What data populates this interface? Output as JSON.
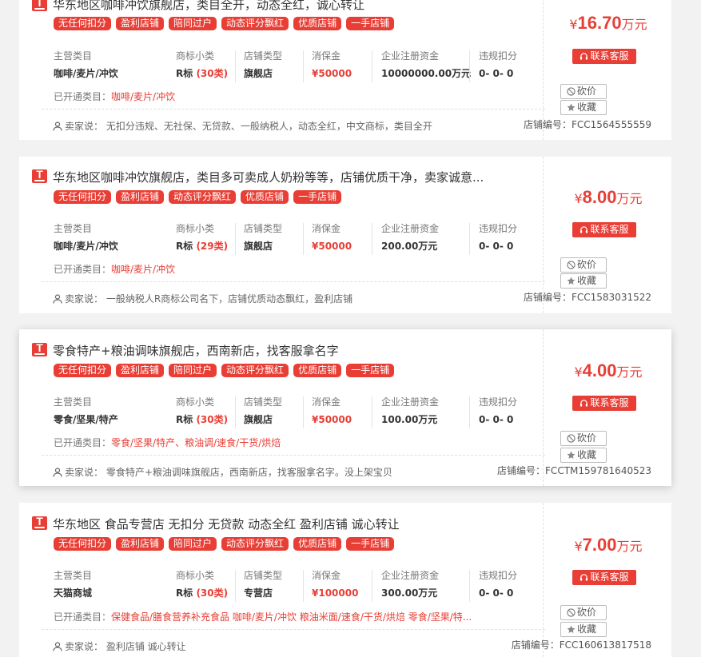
{
  "labels": {
    "main_category": "主营类目",
    "trademark": "商标小类",
    "shop_type": "店铺类型",
    "deposit": "消保金",
    "capital": "企业注册资金",
    "penalty": "违规扣分",
    "opened_cats": "已开通类目：",
    "seller_says": "卖家说：",
    "contact": "联系客服",
    "bargain": "砍价",
    "favorite": "收藏",
    "shop_no": "店铺编号："
  },
  "listings": [
    {
      "title": "华东地区咖啡冲饮旗舰店，类目全开，动态全红，诚心转让",
      "tags": [
        "无任何扣分",
        "盈利店铺",
        "陪同过户",
        "动态评分飘红",
        "优质店铺",
        "一手店铺"
      ],
      "main_category": "咖啡/麦片/冲饮",
      "trademark_prefix": "R标",
      "trademark_count": "(30类)",
      "shop_type": "旗舰店",
      "deposit": "¥50000",
      "capital": "10000000.00万元",
      "penalty": "0- 0- 0",
      "opened_cats": "咖啡/麦片/冲饮",
      "seller_note": "无扣分违规、无社保、无贷款、一般纳税人，动态全红，中文商标，类目全开",
      "price_symbol": "¥",
      "price": "16.70",
      "price_unit": "万元",
      "shop_no": "FCC1564555559"
    },
    {
      "title": "华东地区咖啡冲饮旗舰店，类目多可卖成人奶粉等等，店铺优质干净，卖家诚意...",
      "tags": [
        "无任何扣分",
        "盈利店铺",
        "动态评分飘红",
        "优质店铺",
        "一手店铺"
      ],
      "main_category": "咖啡/麦片/冲饮",
      "trademark_prefix": "R标",
      "trademark_count": "(29类)",
      "shop_type": "旗舰店",
      "deposit": "¥50000",
      "capital": "200.00万元",
      "penalty": "0- 0- 0",
      "opened_cats": "咖啡/麦片/冲饮",
      "seller_note": "一般纳税人R商标公司名下，店铺优质动态飘红，盈利店铺",
      "price_symbol": "¥",
      "price": "8.00",
      "price_unit": "万元",
      "shop_no": "FCC1583031522"
    },
    {
      "title": "零食特产+粮油调味旗舰店，西南新店，找客服拿名字",
      "tags": [
        "无任何扣分",
        "盈利店铺",
        "陪同过户",
        "动态评分飘红",
        "优质店铺",
        "一手店铺"
      ],
      "main_category": "零食/坚果/特产",
      "trademark_prefix": "R标",
      "trademark_count": "(30类)",
      "shop_type": "旗舰店",
      "deposit": "¥50000",
      "capital": "100.00万元",
      "penalty": "0- 0- 0",
      "opened_cats": "零食/坚果/特产、粮油调/速食/干货/烘焙",
      "seller_note": "零食特产+粮油调味旗舰店，西南新店，找客服拿名字。没上架宝贝",
      "price_symbol": "¥",
      "price": "4.00",
      "price_unit": "万元",
      "shop_no": "FCCTM159781640523"
    },
    {
      "title": "华东地区 食品专营店 无扣分 无贷款 动态全红 盈利店铺 诚心转让",
      "tags": [
        "无任何扣分",
        "盈利店铺",
        "陪同过户",
        "动态评分飘红",
        "优质店铺",
        "一手店铺"
      ],
      "main_category": "天猫商城",
      "trademark_prefix": "R标",
      "trademark_count": "(30类)",
      "shop_type": "专营店",
      "deposit": "¥100000",
      "capital": "300.00万元",
      "penalty": "0- 0- 0",
      "opened_cats": "保健食品/膳食营养补充食品 咖啡/麦片/冲饮 粮油米面/速食/干货/烘焙 零食/坚果/特...",
      "seller_note": "盈利店铺 诚心转让",
      "price_symbol": "¥",
      "price": "7.00",
      "price_unit": "万元",
      "shop_no": "FCC160613817518"
    }
  ]
}
